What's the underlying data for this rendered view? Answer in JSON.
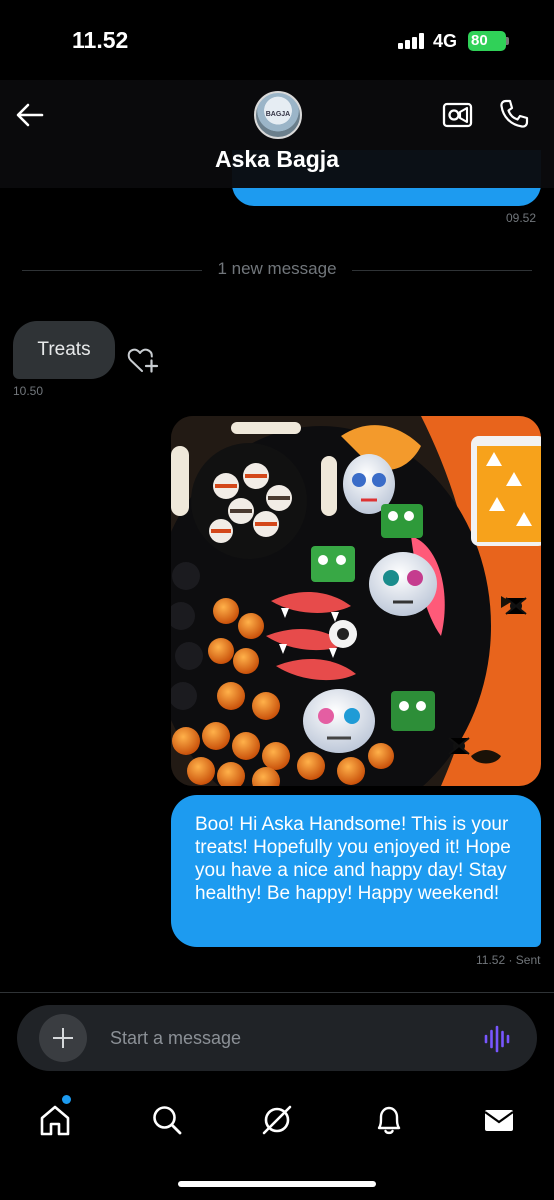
{
  "status_bar": {
    "time": "11.52",
    "network": "4G",
    "battery": "80"
  },
  "header": {
    "contact_name": "Aska Bagja",
    "avatar_text": "BAGJA"
  },
  "messages": {
    "prev_timestamp": "09.52",
    "divider": "1 new message",
    "received_text": "Treats",
    "received_time": "10.50",
    "sent_text": "Boo! Hi Aska Handsome! This is your treats! Hopefully you enjoyed it! Hope you have a nice and happy day! Stay healthy! Be happy! Happy weekend!",
    "sent_meta": "11.52 · Sent"
  },
  "composer": {
    "placeholder": "Start a message"
  },
  "icons": {
    "back": "arrow-left-icon",
    "video": "video-camera-icon",
    "call": "phone-icon",
    "react": "heart-plus-icon",
    "add": "plus-icon",
    "voice": "voice-wave-icon",
    "nav": [
      "home-icon",
      "search-icon",
      "grok-icon",
      "bell-icon",
      "mail-icon"
    ]
  },
  "colors": {
    "accent": "#1d9bf0",
    "received_bubble": "#2f3336",
    "battery": "#30d158",
    "voice": "#7856ff"
  }
}
